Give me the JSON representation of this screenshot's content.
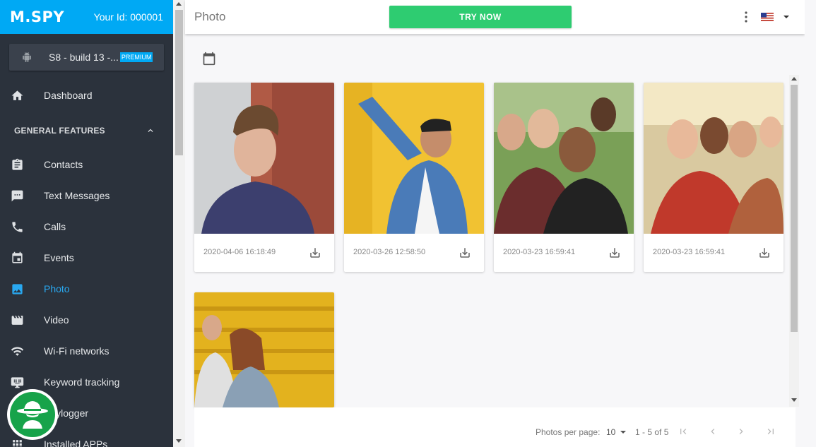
{
  "sidebar": {
    "logo": "M.SPY",
    "your_id": "Your Id: 000001",
    "device_name": "S8 - build 13 -...",
    "device_badge": "PREMIUM",
    "dashboard": "Dashboard",
    "section": "GENERAL FEATURES",
    "items": [
      {
        "label": "Contacts",
        "icon": "contacts-icon"
      },
      {
        "label": "Text Messages",
        "icon": "message-icon"
      },
      {
        "label": "Calls",
        "icon": "phone-icon"
      },
      {
        "label": "Events",
        "icon": "calendar-icon"
      },
      {
        "label": "Photo",
        "icon": "image-icon",
        "active": true
      },
      {
        "label": "Video",
        "icon": "video-icon"
      },
      {
        "label": "Wi-Fi networks",
        "icon": "wifi-icon"
      },
      {
        "label": "Keyword tracking",
        "icon": "keyboard-icon"
      },
      {
        "label": "Keylogger",
        "icon": "keylogger-icon"
      },
      {
        "label": "Installed APPs",
        "icon": "apps-icon"
      }
    ]
  },
  "header": {
    "title": "Photo",
    "try_button": "TRY NOW"
  },
  "photos": [
    {
      "date": "2020-04-06 16:18:49"
    },
    {
      "date": "2020-03-26 12:58:50"
    },
    {
      "date": "2020-03-23 16:59:41"
    },
    {
      "date": "2020-03-23 16:59:41"
    },
    {
      "date": ""
    }
  ],
  "pagination": {
    "per_page_label": "Photos per page:",
    "per_page": "10",
    "range": "1 - 5 of 5"
  },
  "colors": {
    "accent": "#00a9f4",
    "sidebar": "#2b323c",
    "active": "#29a8f0",
    "try_button": "#2ecc71"
  }
}
